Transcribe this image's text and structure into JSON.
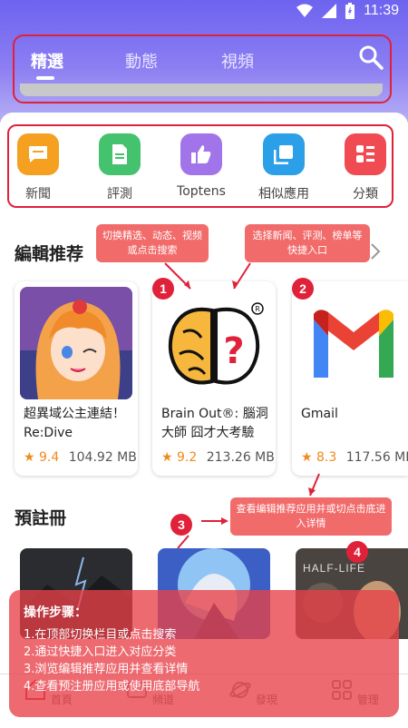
{
  "status_bar": {
    "time": "11:39"
  },
  "tabs": [
    {
      "label": "精選",
      "active": true
    },
    {
      "label": "動態",
      "active": false
    },
    {
      "label": "視頻",
      "active": false
    }
  ],
  "quick_entries": [
    {
      "label": "新聞",
      "icon": "news-icon",
      "color": "#f5a020"
    },
    {
      "label": "評測",
      "icon": "review-icon",
      "color": "#44c26e"
    },
    {
      "label": "Toptens",
      "icon": "thumbs-up-icon",
      "color": "#a274ea"
    },
    {
      "label": "相似應用",
      "icon": "similar-apps-icon",
      "color": "#2b9fe8"
    },
    {
      "label": "分類",
      "icon": "category-icon",
      "color": "#f04b52"
    }
  ],
  "editors_pick": {
    "title": "編輯推荐",
    "apps": [
      {
        "name": "超異域公主連結！Re:Dive",
        "score": "9.4",
        "size": "104.92 MB"
      },
      {
        "name": "Brain Out®: 腦洞大師 囧才大考驗",
        "score": "9.2",
        "size": "213.26 MB"
      },
      {
        "name": "Gmail",
        "score": "8.3",
        "size": "117.56 MB"
      }
    ]
  },
  "pre_register": {
    "title": "預註冊"
  },
  "callouts": {
    "tabs": "切换精选、动态、视频或点击搜索",
    "entries": "选择新闻、评测、榜单等快捷入口",
    "details": "查看编辑推荐应用并或切点击底进入详情"
  },
  "badges": [
    "1",
    "2",
    "3",
    "4"
  ],
  "steps": {
    "title": "操作步骤：",
    "items": [
      "1.在顶部切换栏目或点击搜索",
      "2.通过快捷入口进入对应分类",
      "3.浏览编辑推荐应用并查看详情",
      "4.查看预注册应用或使用底部导航"
    ]
  },
  "bottom_nav": [
    {
      "label": "首頁",
      "icon": "home-icon"
    },
    {
      "label": "頻道",
      "icon": "channel-icon"
    },
    {
      "label": "發現",
      "icon": "discover-icon"
    },
    {
      "label": "管理",
      "icon": "manage-icon"
    }
  ]
}
